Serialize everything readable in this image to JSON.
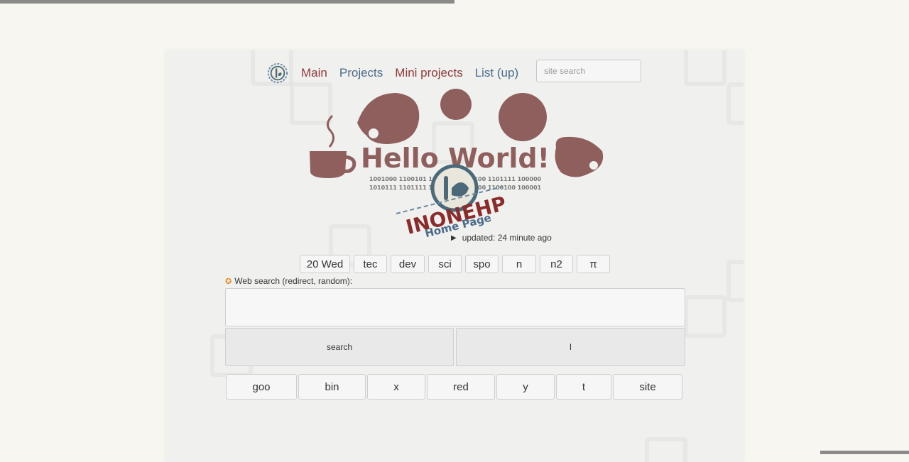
{
  "nav": {
    "items": [
      {
        "label": "Main",
        "color": "#8b3a3a"
      },
      {
        "label": "Projects",
        "color": "#4a6a8a"
      },
      {
        "label": "Mini projects",
        "color": "#8b3a3a"
      },
      {
        "label": "List (up)",
        "color": "#4a6a8a"
      }
    ],
    "search_placeholder": "site search"
  },
  "hero": {
    "headline": "Hello World!",
    "binary_line1": "1001000 1100101 1101100 1101100 1101111 100000",
    "binary_line2": "1010111 1101111 1110010 1101100 1100100 100001",
    "brand": "INONEHP",
    "subtitle": "Home Page"
  },
  "updated": "updated: 24 minute ago",
  "tabs": [
    "20 Wed",
    "tec",
    "dev",
    "sci",
    "spo",
    "n",
    "n2",
    "π"
  ],
  "web_search": {
    "label": "Web search (redirect, random):",
    "search_button": "search",
    "lucky_button": "l",
    "engines": [
      "goo",
      "bin",
      "x",
      "red",
      "y",
      "t",
      "site"
    ]
  },
  "colors": {
    "brand_red": "#8b3a3a",
    "brand_blue": "#4a6a8a",
    "blob": "#8e5f5c",
    "gear": "#e58a1f"
  }
}
